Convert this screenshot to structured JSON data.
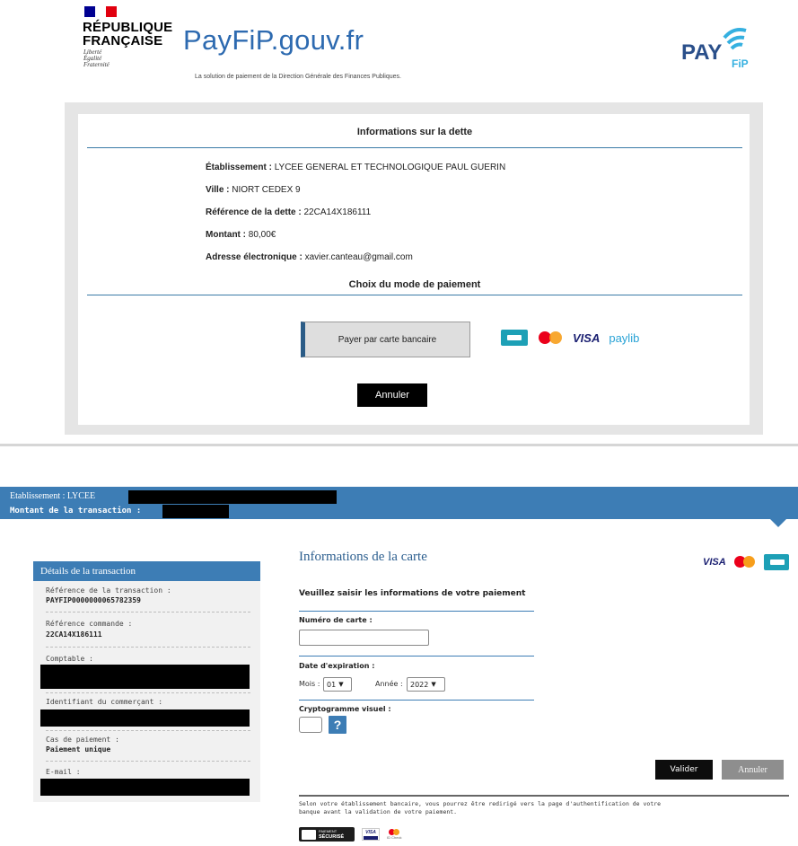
{
  "header": {
    "rf_name_line1": "RÉPUBLIQUE",
    "rf_name_line2": "FRANÇAISE",
    "rf_motto_1": "Liberté",
    "rf_motto_2": "Égalité",
    "rf_motto_3": "Fraternité",
    "site_title": "PayFiP.gouv.fr",
    "subtitle": "La solution de paiement de la Direction Générale des Finances Publiques.",
    "pay_logo_text": "PAY",
    "pay_logo_sub": "FiP"
  },
  "debt": {
    "section_title": "Informations sur la dette",
    "rows": [
      {
        "label": "Établissement :",
        "value": "LYCEE GENERAL ET TECHNOLOGIQUE PAUL GUERIN"
      },
      {
        "label": "Ville :",
        "value": "NIORT CEDEX 9"
      },
      {
        "label": "Référence de la dette :",
        "value": "22CA14X186111"
      },
      {
        "label": "Montant :",
        "value": "80,00€"
      },
      {
        "label": "Adresse électronique :",
        "value": "xavier.canteau@gmail.com"
      }
    ]
  },
  "payment_mode": {
    "section_title": "Choix du mode de paiement",
    "card_button": "Payer par carte bancaire",
    "visa_label": "VISA",
    "paylib_label": "paylib",
    "cancel_button": "Annuler"
  },
  "bank_banner": {
    "establishment_label": "Etablissement : LYCEE",
    "amount_label": "Montant de la transaction :"
  },
  "transaction": {
    "title": "Détails de la transaction",
    "fields": [
      {
        "label": "Référence de la transaction :",
        "value": "PAYFIP0000000065782359"
      },
      {
        "label": "Référence commande :",
        "value": "22CA14X186111"
      },
      {
        "label": "Comptable :",
        "value": ""
      },
      {
        "label": "Identifiant du commerçant :",
        "value": ""
      },
      {
        "label": "Cas de paiement :",
        "value": "Paiement unique"
      },
      {
        "label": "E-mail :",
        "value": ""
      }
    ]
  },
  "card_form": {
    "title": "Informations de la carte",
    "visa_label": "VISA",
    "intro": "Veuillez saisir les informations de votre paiement",
    "card_number_label": "Numéro de carte :",
    "card_number_value": "",
    "expiry_label": "Date d'expiration :",
    "month_label": "Mois :",
    "month_value": "01",
    "year_label": "Année :",
    "year_value": "2022",
    "cvv_label": "Cryptogramme visuel :",
    "help_label": "?",
    "validate_button": "Valider",
    "cancel_button": "Annuler",
    "footer_note": "Selon votre établissement bancaire, vous pourrez être redirigé vers la page d'authentification de votre banque avant la validation de votre paiement.",
    "secure_badge_line1": "PAIEMENT",
    "secure_badge_line2": "SÉCURISÉ",
    "mini_visa": "VISA",
    "id_check": "ID Check"
  },
  "colors": {
    "accent_blue": "#3d7db5",
    "payfip_blue": "#2d6ab0",
    "flag_blue": "#000091",
    "flag_red": "#e1000f",
    "cb_teal": "#1da0b6",
    "mastercard_red": "#eb001b",
    "mastercard_orange": "#f79e1b",
    "visa_navy": "#1a1f71"
  }
}
